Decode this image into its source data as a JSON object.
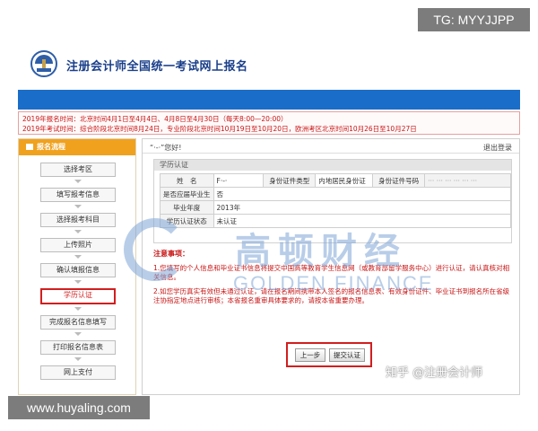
{
  "overlay": {
    "tg_label": "TG: MYYJJPP",
    "url_label": "www.huyaling.com",
    "zhihu_label": "知乎 @注册会计师"
  },
  "header": {
    "title": "注册会计师全国统一考试网上报名"
  },
  "notice": {
    "line1": "2019年报名时间：北京时间4月1日至4月4日、4月8日至4月30日（每天8:00—20:00）",
    "line2": "2019年考试时间：综合阶段北京时间8月24日，专业阶段北京时间10月19日至10月20日，欧洲考区北京时间10月26日至10月27日"
  },
  "sidebar": {
    "header": "报名流程",
    "steps": [
      "选择考区",
      "填写报考信息",
      "选择报考科目",
      "上传照片",
      "确认填报信息",
      "学历认证",
      "完成报名信息填写",
      "打印报名信息表",
      "网上支付"
    ],
    "active_index": 5
  },
  "main": {
    "greeting": "“·-·”您好!",
    "logout": "退出登录",
    "panel_title": "学历认证",
    "table": {
      "row1": [
        "姓　名",
        "F·-·",
        "身份证件类型",
        "内地居民身份证",
        "身份证件号码",
        "··· ··· ··· ··· ··· ···"
      ],
      "row2": [
        "是否应届毕业生",
        "否"
      ],
      "row3": [
        "毕业年度",
        "2013年"
      ],
      "row4": [
        "学历认证状态",
        "未认证"
      ]
    },
    "cautions_title": "注意事项：",
    "caution1": "1.您填写的个人信息和毕业证书信息将提交中国高等教育学生信息网（或教育部留学服务中心）进行认证，请认真核对相关信息。",
    "caution2": "2.如您学历真实有效但未通过认证，请在报名期间携带本人签名的报名信息表、有效身份证件、毕业证书到报名所在省级注协指定地点进行审核；本省报名重审具体要求的，请按本省重要办理。",
    "btn_prev": "上一步",
    "btn_submit": "提交认证"
  },
  "watermark": {
    "cn": "高顿财经",
    "en": "GOLDEN FINANCE"
  },
  "colors": {
    "brand_blue": "#1a6dc8",
    "sidebar_orange": "#f0a11e",
    "alert_red": "#c81414",
    "highlight_red": "#d21e1e"
  }
}
